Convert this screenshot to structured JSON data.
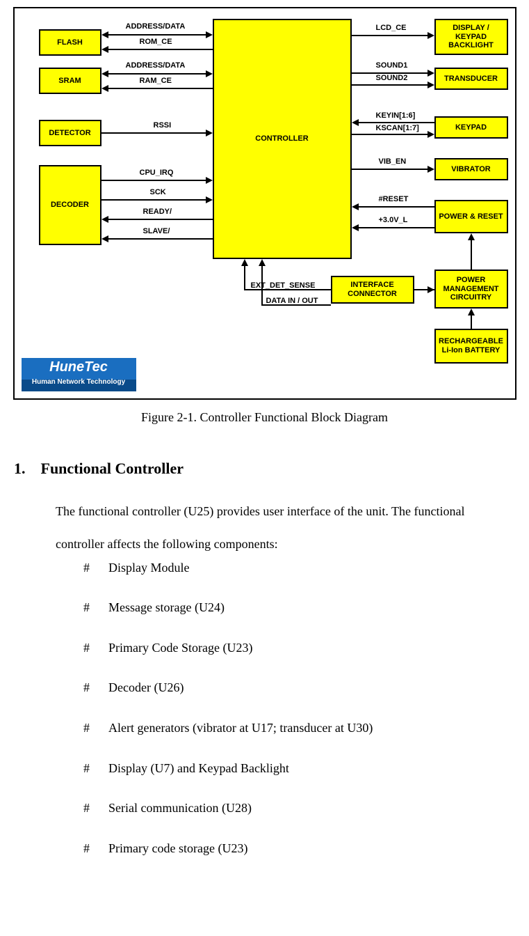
{
  "diagram": {
    "blocks": {
      "flash": "FLASH",
      "sram": "SRAM",
      "detector": "DETECTOR",
      "decoder": "DECODER",
      "controller": "CONTROLLER",
      "display_keypad_backlight": "DISPLAY / KEYPAD BACKLIGHT",
      "transducer": "TRANSDUCER",
      "keypad": "KEYPAD",
      "vibrator": "VIBRATOR",
      "power_reset": "POWER & RESET",
      "interface_connector": "INTERFACE CONNECTOR",
      "power_mgmt": "POWER MANAGEMENT CIRCUITRY",
      "battery": "RECHARGEABLE Li-Ion BATTERY"
    },
    "signals": {
      "address_data_1": "ADDRESS/DATA",
      "rom_ce": "ROM_CE",
      "address_data_2": "ADDRESS/DATA",
      "ram_ce": "RAM_CE",
      "rssi": "RSSI",
      "cpu_irq": "CPU_IRQ",
      "sck": "SCK",
      "ready": "READY/",
      "slave": "SLAVE/",
      "lcd_ce": "LCD_CE",
      "sound1": "SOUND1",
      "sound2": "SOUND2",
      "keyin": "KEYIN[1:6]",
      "kscan": "KSCAN[1:7]",
      "vib_en": "VIB_EN",
      "reset": "#RESET",
      "v3": "+3.0V_L",
      "ext_det_sense": "EXT_DET_SENSE",
      "data_io": "DATA IN / OUT"
    },
    "logo": {
      "main": "HuneTec",
      "sub": "Human Network Technology"
    }
  },
  "caption": "Figure 2-1. Controller Functional Block Diagram",
  "section": {
    "number": "1.",
    "title": "Functional Controller",
    "intro": "The functional controller (U25) provides user interface of the unit. The functional controller affects the following components:",
    "bullet": "#",
    "items": [
      "Display Module",
      "Message storage (U24)",
      "Primary Code Storage (U23)",
      "Decoder (U26)",
      "Alert generators (vibrator at U17; transducer at U30)",
      "Display (U7) and Keypad Backlight",
      "Serial communication (U28)",
      "Primary code storage (U23)"
    ]
  }
}
